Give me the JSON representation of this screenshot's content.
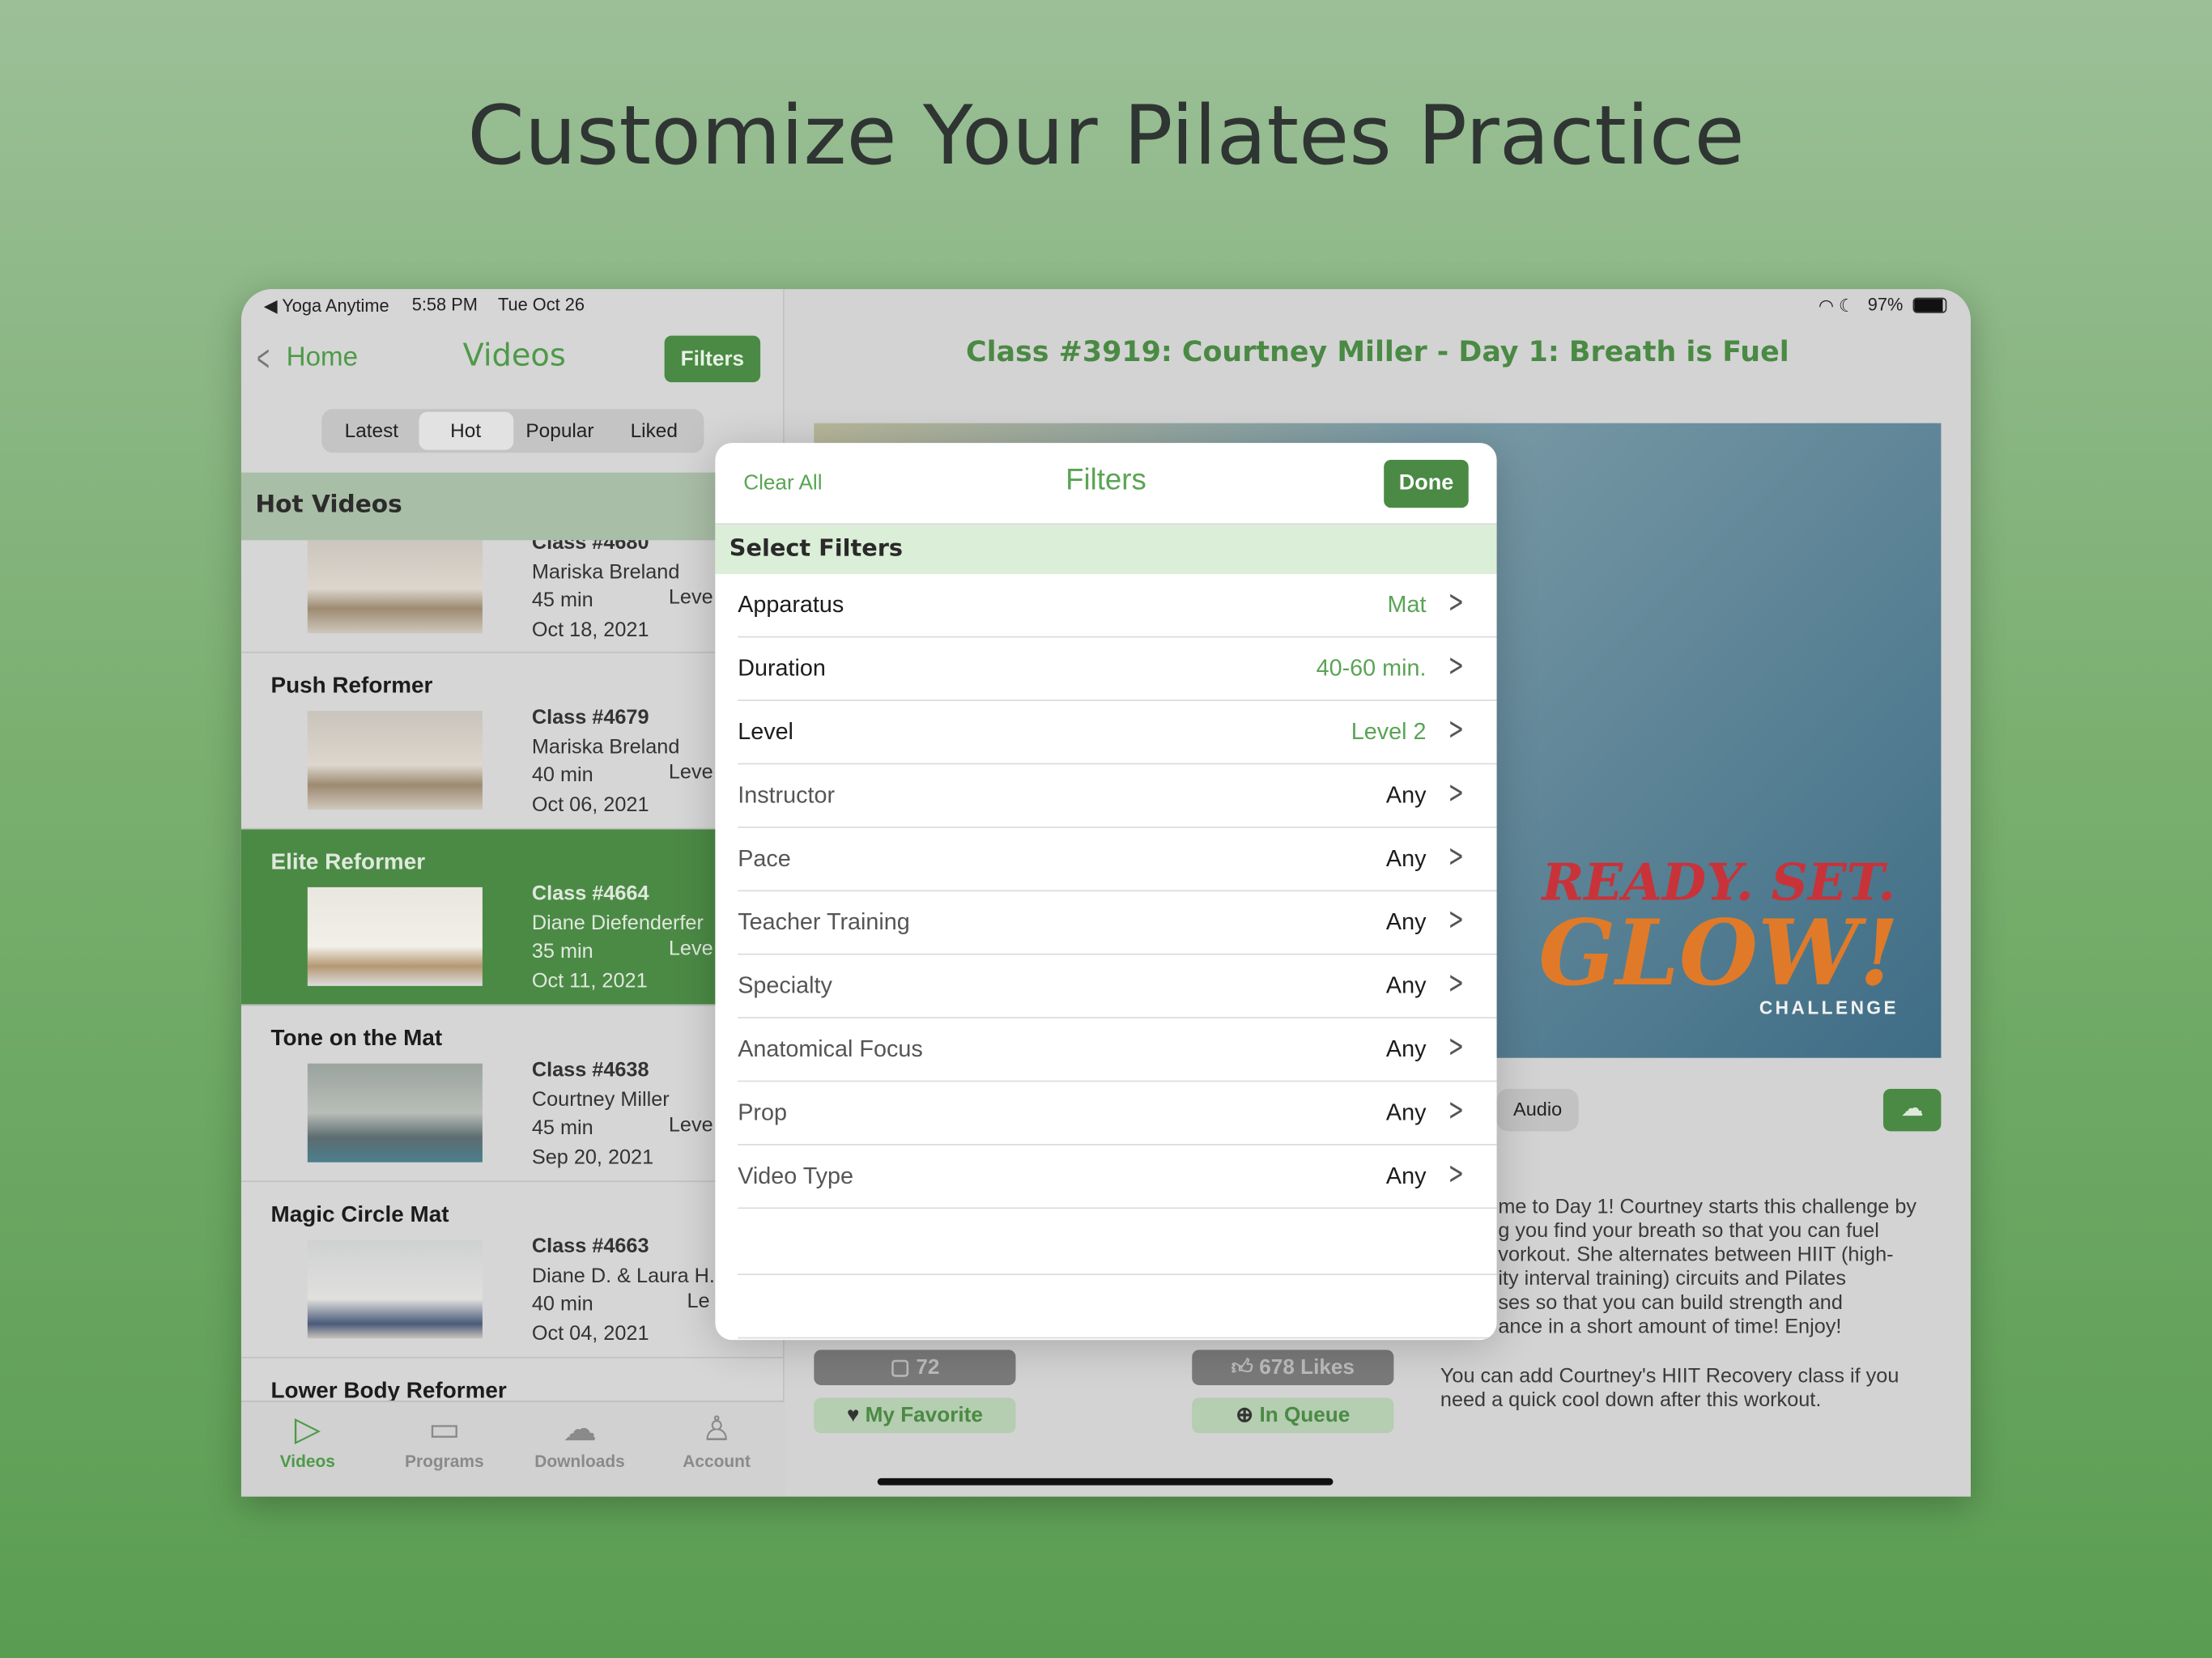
{
  "headline": "Customize Your Pilates Practice",
  "status": {
    "back_app": "◀ Yoga Anytime",
    "time": "5:58 PM",
    "date": "Tue Oct 26",
    "battery": "97%"
  },
  "nav": {
    "back": "Home",
    "title": "Videos",
    "filters": "Filters"
  },
  "segments": [
    "Latest",
    "Hot",
    "Popular",
    "Liked"
  ],
  "selected_segment": "Hot",
  "list_header": "Hot Videos",
  "videos": [
    {
      "title": "",
      "class": "Class #4680",
      "instructor": "Mariska Breland",
      "duration": "45 min",
      "level": "Leve",
      "date": "Oct 18, 2021"
    },
    {
      "title": "Push Reformer",
      "class": "Class #4679",
      "instructor": "Mariska Breland",
      "duration": "40 min",
      "level": "Leve",
      "date": "Oct 06, 2021"
    },
    {
      "title": "Elite Reformer",
      "class": "Class #4664",
      "instructor": "Diane Diefenderfer",
      "duration": "35 min",
      "level": "Leve",
      "date": "Oct 11, 2021"
    },
    {
      "title": "Tone on the Mat",
      "class": "Class #4638",
      "instructor": "Courtney Miller",
      "duration": "45 min",
      "level": "Leve",
      "date": "Sep 20, 2021"
    },
    {
      "title": "Magic Circle Mat",
      "class": "Class #4663",
      "instructor": "Diane D. & Laura H.",
      "duration": "40 min",
      "level": "Le",
      "date": "Oct 04, 2021"
    },
    {
      "title": "Lower Body Reformer"
    }
  ],
  "tabs": [
    {
      "label": "Videos",
      "icon": "play-icon"
    },
    {
      "label": "Programs",
      "icon": "monitor-icon"
    },
    {
      "label": "Downloads",
      "icon": "cloud-download-icon"
    },
    {
      "label": "Account",
      "icon": "person-icon"
    }
  ],
  "detail": {
    "title": "Class #3919: Courtney Miller - Day 1: Breath is Fuel",
    "logo": {
      "line1": "READY. SET.",
      "line2": "GLOW!",
      "line3": "CHALLENGE"
    },
    "audio": "Audio",
    "description": [
      "me to Day 1! Courtney starts this challenge by",
      "g you find your breath so that you can fuel",
      "vorkout. She alternates between HIIT (high-",
      "ity interval training) circuits and Pilates",
      "ses so that you can build strength and",
      "ance in a short amount of time! Enjoy!"
    ],
    "note": "You can add Courtney's HIIT Recovery class if you need a quick cool down after this workout.",
    "comments": "72",
    "likes": "678 Likes",
    "favorite": "My Favorite",
    "queue": "In Queue"
  },
  "modal": {
    "clear": "Clear All",
    "title": "Filters",
    "done": "Done",
    "section": "Select Filters",
    "rows": [
      {
        "label": "Apparatus",
        "value": "Mat",
        "active": true
      },
      {
        "label": "Duration",
        "value": "40-60 min.",
        "active": true
      },
      {
        "label": "Level",
        "value": "Level 2",
        "active": true
      },
      {
        "label": "Instructor",
        "value": "Any",
        "active": false
      },
      {
        "label": "Pace",
        "value": "Any",
        "active": false
      },
      {
        "label": "Teacher Training",
        "value": "Any",
        "active": false
      },
      {
        "label": "Specialty",
        "value": "Any",
        "active": false
      },
      {
        "label": "Anatomical Focus",
        "value": "Any",
        "active": false
      },
      {
        "label": "Prop",
        "value": "Any",
        "active": false
      },
      {
        "label": "Video Type",
        "value": "Any",
        "active": false
      }
    ]
  },
  "colors": {
    "brand_green": "#4a8a44",
    "accent_text": "#5aa454",
    "section_bg": "#dbeed7"
  }
}
